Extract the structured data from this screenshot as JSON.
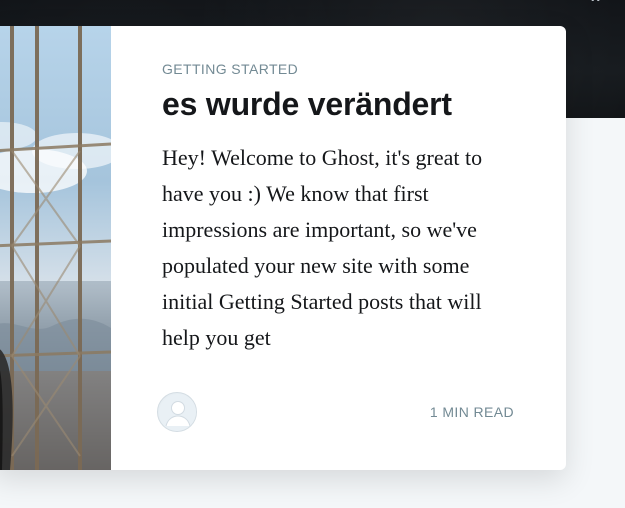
{
  "card": {
    "primary_tag": "Getting Started",
    "title": "es wurde verändert",
    "excerpt": "Hey! Welcome to Ghost, it's great to have you :) We know that first impressions are important, so we've populated your new site with some initial Getting Started posts that will help you get",
    "reading_time": "1 min read"
  },
  "icons": {
    "author_avatar": "user-avatar-icon",
    "header_menu": "dots-icon"
  },
  "colors": {
    "header_bg": "#15191d",
    "card_bg": "#ffffff",
    "page_bg": "#f4f7f9",
    "meta_text": "#738a94",
    "title_text": "#15171a"
  }
}
